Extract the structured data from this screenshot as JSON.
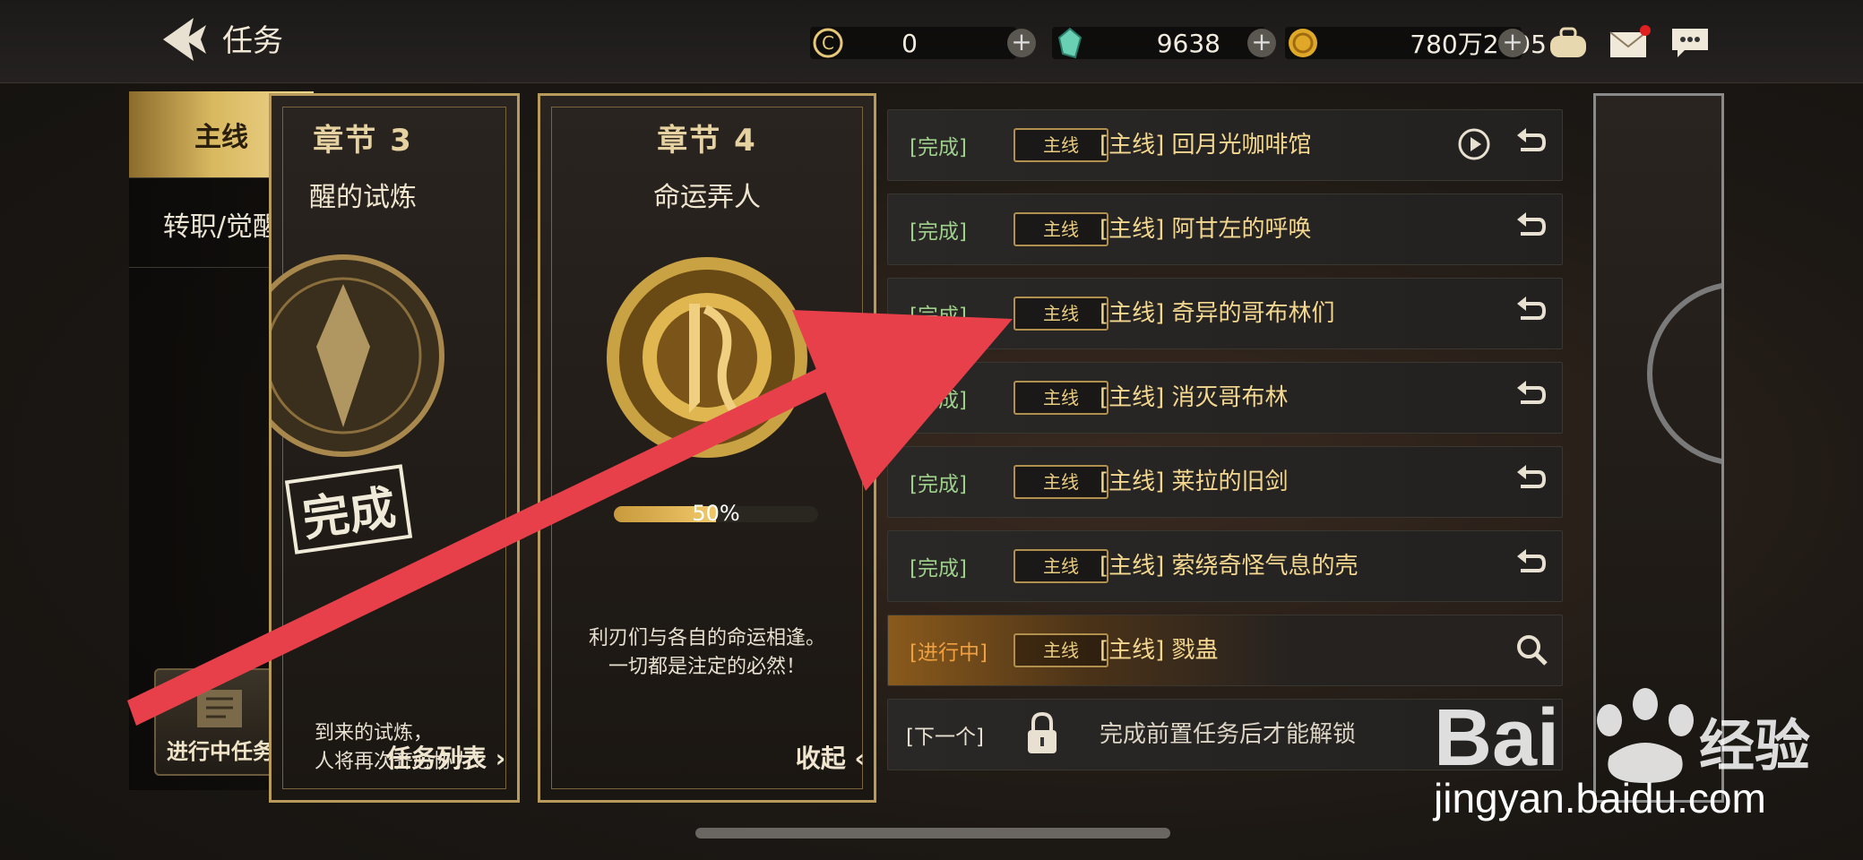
{
  "header": {
    "title": "任务",
    "currencies": [
      {
        "icon": "c-coin-icon",
        "value": "0"
      },
      {
        "icon": "green-crystal-icon",
        "value": "9638"
      },
      {
        "icon": "gold-coin-icon",
        "value": "780万2795"
      }
    ],
    "plus_label": "+"
  },
  "sidebar": {
    "items": [
      {
        "label": "主线",
        "active": true
      },
      {
        "label": "转职/觉醒",
        "active": false
      }
    ],
    "ongoing_button": "进行中任务"
  },
  "chapters": [
    {
      "chapter": "章节 3",
      "name": "醒的试炼",
      "stamp": "完成",
      "desc_line1": "到来的试炼，",
      "desc_line2": "人将再次齐心协力！",
      "link": "任务列表"
    },
    {
      "chapter": "章节 4",
      "name": "命运弄人",
      "progress": 0.5,
      "progress_label": "50%",
      "desc_line1": "利刃们与各自的命运相逢。",
      "desc_line2": "一切都是注定的必然！",
      "link": "收起"
    }
  ],
  "quests": [
    {
      "status": "[完成]",
      "tag": "主线",
      "name": "[主线] 回月光咖啡馆",
      "icons": [
        "play-icon",
        "return-icon"
      ]
    },
    {
      "status": "[完成]",
      "tag": "主线",
      "name": "[主线] 阿甘左的呼唤",
      "icons": [
        "return-icon"
      ]
    },
    {
      "status": "[完成]",
      "tag": "主线",
      "name": "[主线] 奇异的哥布林们",
      "icons": [
        "return-icon"
      ]
    },
    {
      "status": "[完成]",
      "tag": "主线",
      "name": "[主线] 消灭哥布林",
      "icons": [
        "return-icon"
      ]
    },
    {
      "status": "[完成]",
      "tag": "主线",
      "name": "[主线] 莱拉的旧剑",
      "icons": [
        "return-icon"
      ]
    },
    {
      "status": "[完成]",
      "tag": "主线",
      "name": "[主线] 萦绕奇怪气息的壳",
      "icons": [
        "return-icon"
      ]
    },
    {
      "status": "[进行中]",
      "tag": "主线",
      "name": "[主线] 戮蛊",
      "icons": [
        "search-icon"
      ]
    }
  ],
  "next": {
    "status": "[下一个]",
    "text": "完成前置任务后才能解锁"
  },
  "watermark": {
    "brand": "Bai经验",
    "url": "jingyan.baidu.com"
  },
  "colors": {
    "accent_gold": "#d8b860",
    "done_green": "#9ed08c",
    "doing_orange": "#f0a040",
    "annotation_red": "#e8404a"
  }
}
